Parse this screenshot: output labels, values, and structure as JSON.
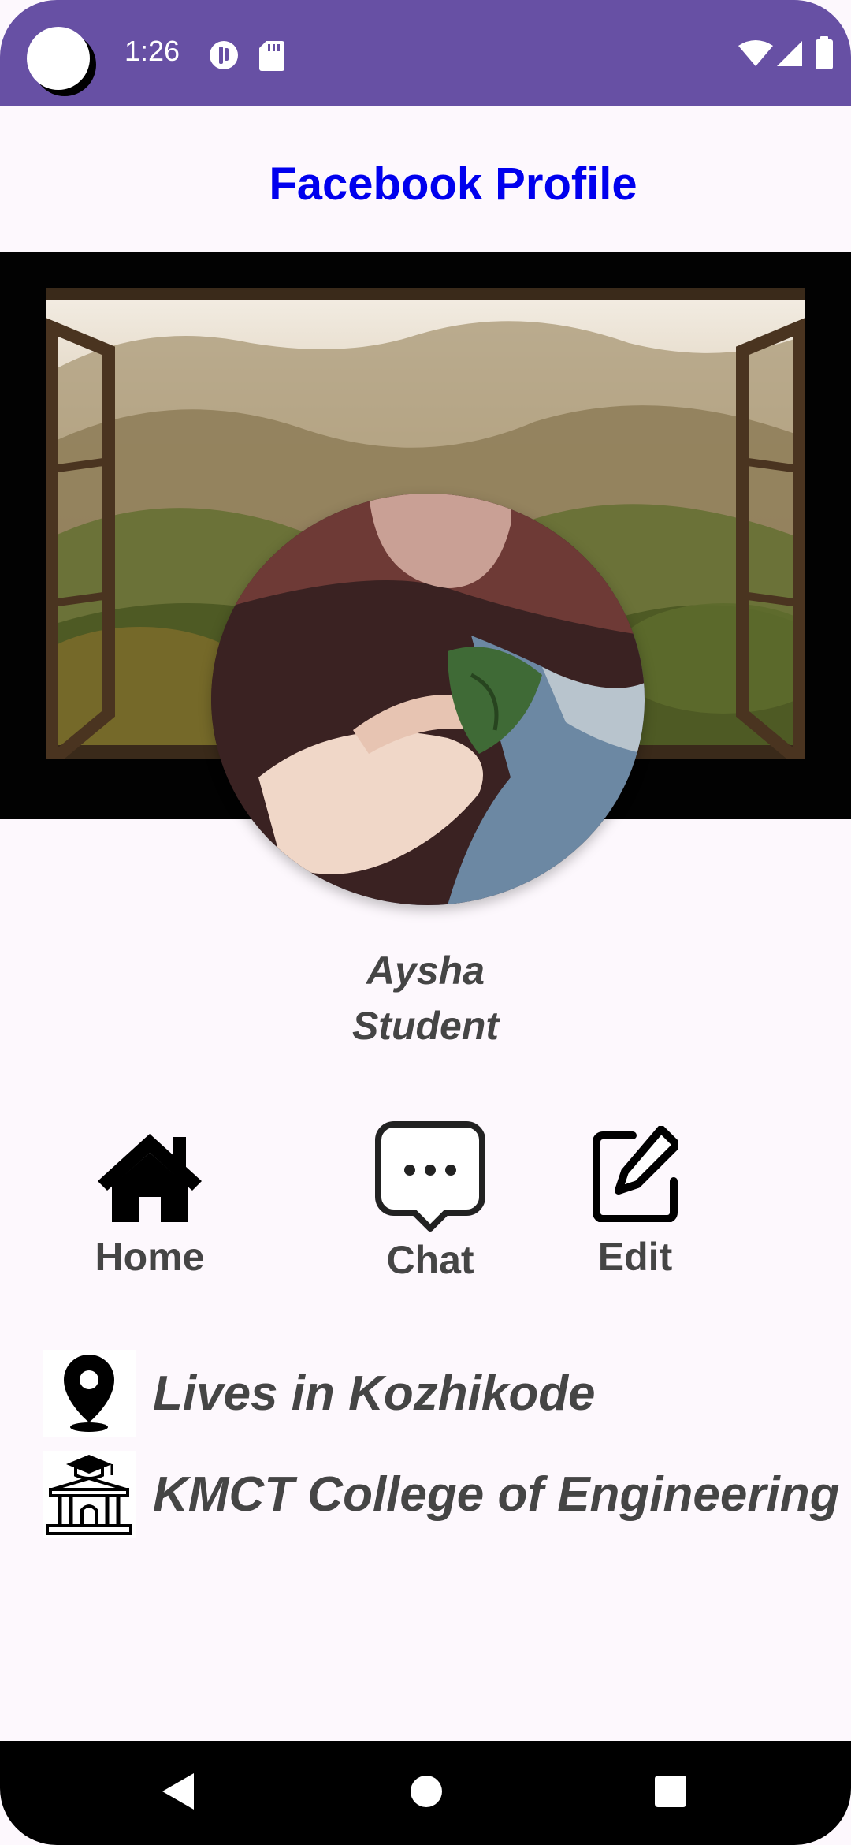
{
  "status_bar": {
    "time": "1:26",
    "colors": {
      "background": "#6750a4",
      "icons": "#ffffff"
    },
    "icons": [
      "camera-cutout-icon",
      "data-saver-icon",
      "sd-card-icon",
      "wifi-icon",
      "cell-signal-icon",
      "battery-icon"
    ]
  },
  "header": {
    "title": "Facebook Profile",
    "title_color": "#0000ee"
  },
  "cover": {
    "icon": "cover-photo-window-landscape"
  },
  "profile": {
    "name": "Aysha",
    "role": "Student",
    "avatar_icon": "profile-photo"
  },
  "actions": [
    {
      "label": "Home",
      "icon": "home-icon"
    },
    {
      "label": "Chat",
      "icon": "chat-icon"
    },
    {
      "label": "Edit",
      "icon": "edit-icon"
    }
  ],
  "info": {
    "location": {
      "text": "Lives in Kozhikode",
      "icon": "location-pin-icon"
    },
    "education": {
      "text": "KMCT College of Engineering",
      "icon": "college-icon"
    }
  },
  "nav_bar": {
    "buttons": [
      "back-icon",
      "home-circle-icon",
      "recents-icon"
    ]
  }
}
